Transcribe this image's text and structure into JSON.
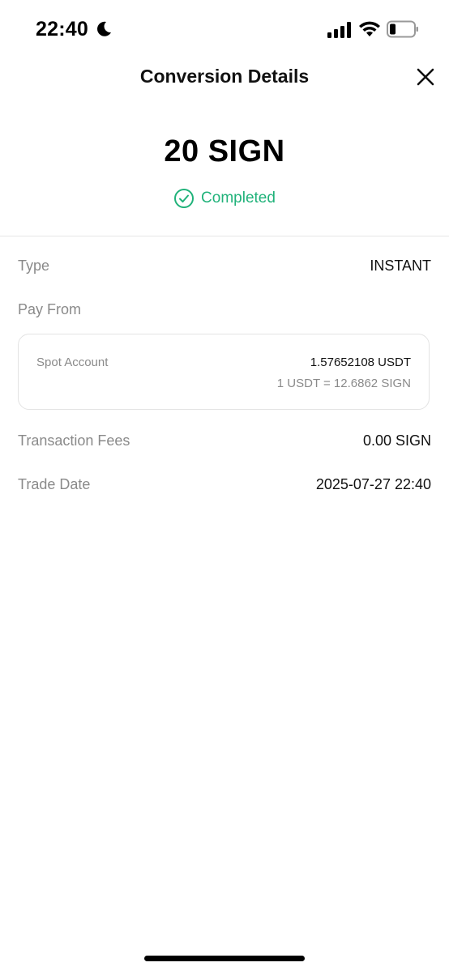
{
  "status_bar": {
    "time": "22:40"
  },
  "header": {
    "title": "Conversion Details"
  },
  "summary": {
    "amount": "20 SIGN",
    "status": "Completed",
    "status_color": "#20b27a"
  },
  "details": {
    "type_label": "Type",
    "type_value": "INSTANT",
    "pay_from_label": "Pay From",
    "pay_from": {
      "account": "Spot Account",
      "amount": "1.57652108 USDT",
      "rate": "1 USDT = 12.6862 SIGN"
    },
    "fees_label": "Transaction Fees",
    "fees_value": "0.00 SIGN",
    "date_label": "Trade Date",
    "date_value": "2025-07-27 22:40"
  }
}
